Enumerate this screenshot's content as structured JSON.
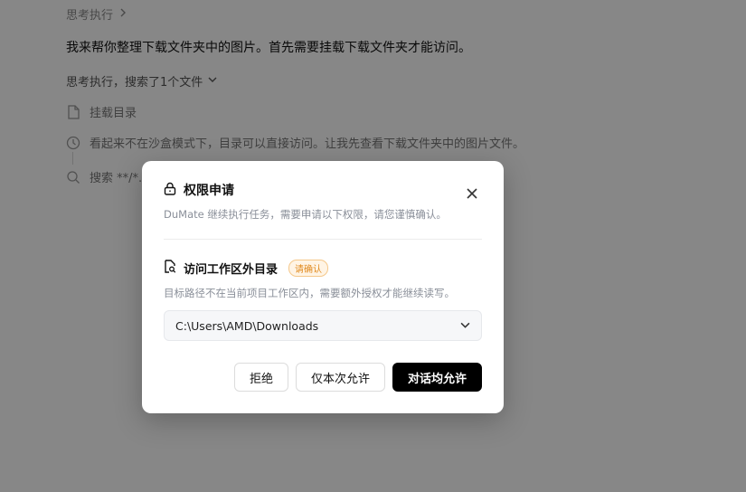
{
  "chat": {
    "thinking_header": "思考执行",
    "assistant_message": "我来帮你整理下载文件夹中的图片。首先需要挂载下载文件夹才能访问。",
    "thinking_header2": "思考执行，搜索了1个文件",
    "steps": [
      {
        "icon": "file-icon",
        "text": "挂载目录"
      },
      {
        "icon": "clock-icon",
        "text": "看起来不在沙盒模式下，目录可以直接访问。让我先查看下载文件夹中的图片文件。"
      },
      {
        "icon": "search-icon",
        "text": "搜索 **/*."
      }
    ]
  },
  "modal": {
    "title": "权限申请",
    "subtitle": "DuMate 继续执行任务，需要申请以下权限，请您谨慎确认。",
    "section_title": "访问工作区外目录",
    "badge": "请确认",
    "section_desc": "目标路径不在当前项目工作区内，需要额外授权才能继续读写。",
    "path_value": "C:\\Users\\AMD\\Downloads",
    "buttons": {
      "reject": "拒绝",
      "allow_once": "仅本次允许",
      "allow_session": "对话均允许"
    }
  }
}
